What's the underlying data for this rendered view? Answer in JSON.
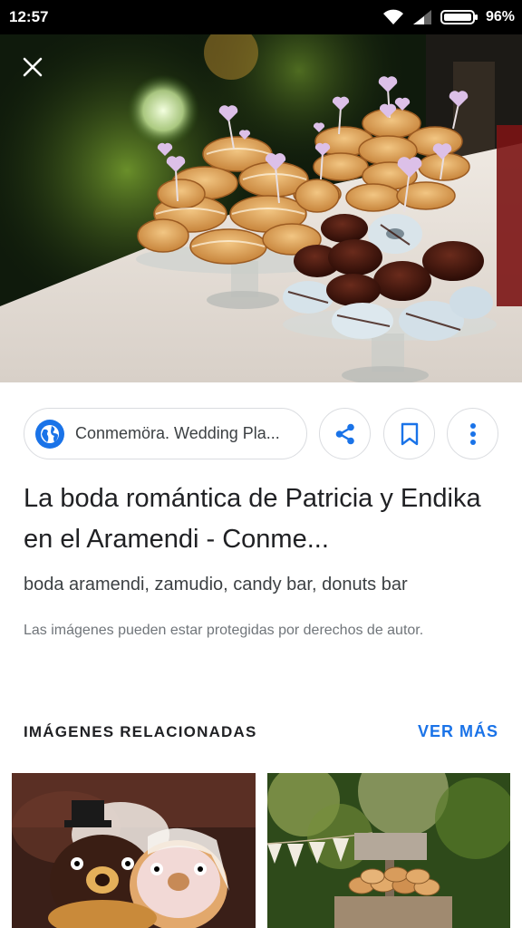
{
  "status_bar": {
    "time": "12:57",
    "battery": "96%",
    "icons": [
      "wifi-icon",
      "signal-icon",
      "battery-icon"
    ]
  },
  "viewer": {
    "close_icon": "close-icon"
  },
  "source": {
    "label": "Conmemöra. Wedding Pla...",
    "icon": "globe-icon"
  },
  "actions": {
    "share_icon": "share-icon",
    "bookmark_icon": "bookmark-icon",
    "more_icon": "more-vertical-icon"
  },
  "result": {
    "title": "La boda romántica de Patricia y Endika en el Aramendi - Conme...",
    "tags": "boda aramendi, zamudio, candy bar, donuts bar",
    "copyright": "Las imágenes pueden estar protegidas por derechos de autor."
  },
  "related": {
    "title": "IMÁGENES RELACIONADAS",
    "see_more": "VER MÁS"
  },
  "colors": {
    "accent": "#1a73e8",
    "text_primary": "#202124",
    "text_secondary": "#70757a",
    "outline": "#dadce0"
  }
}
